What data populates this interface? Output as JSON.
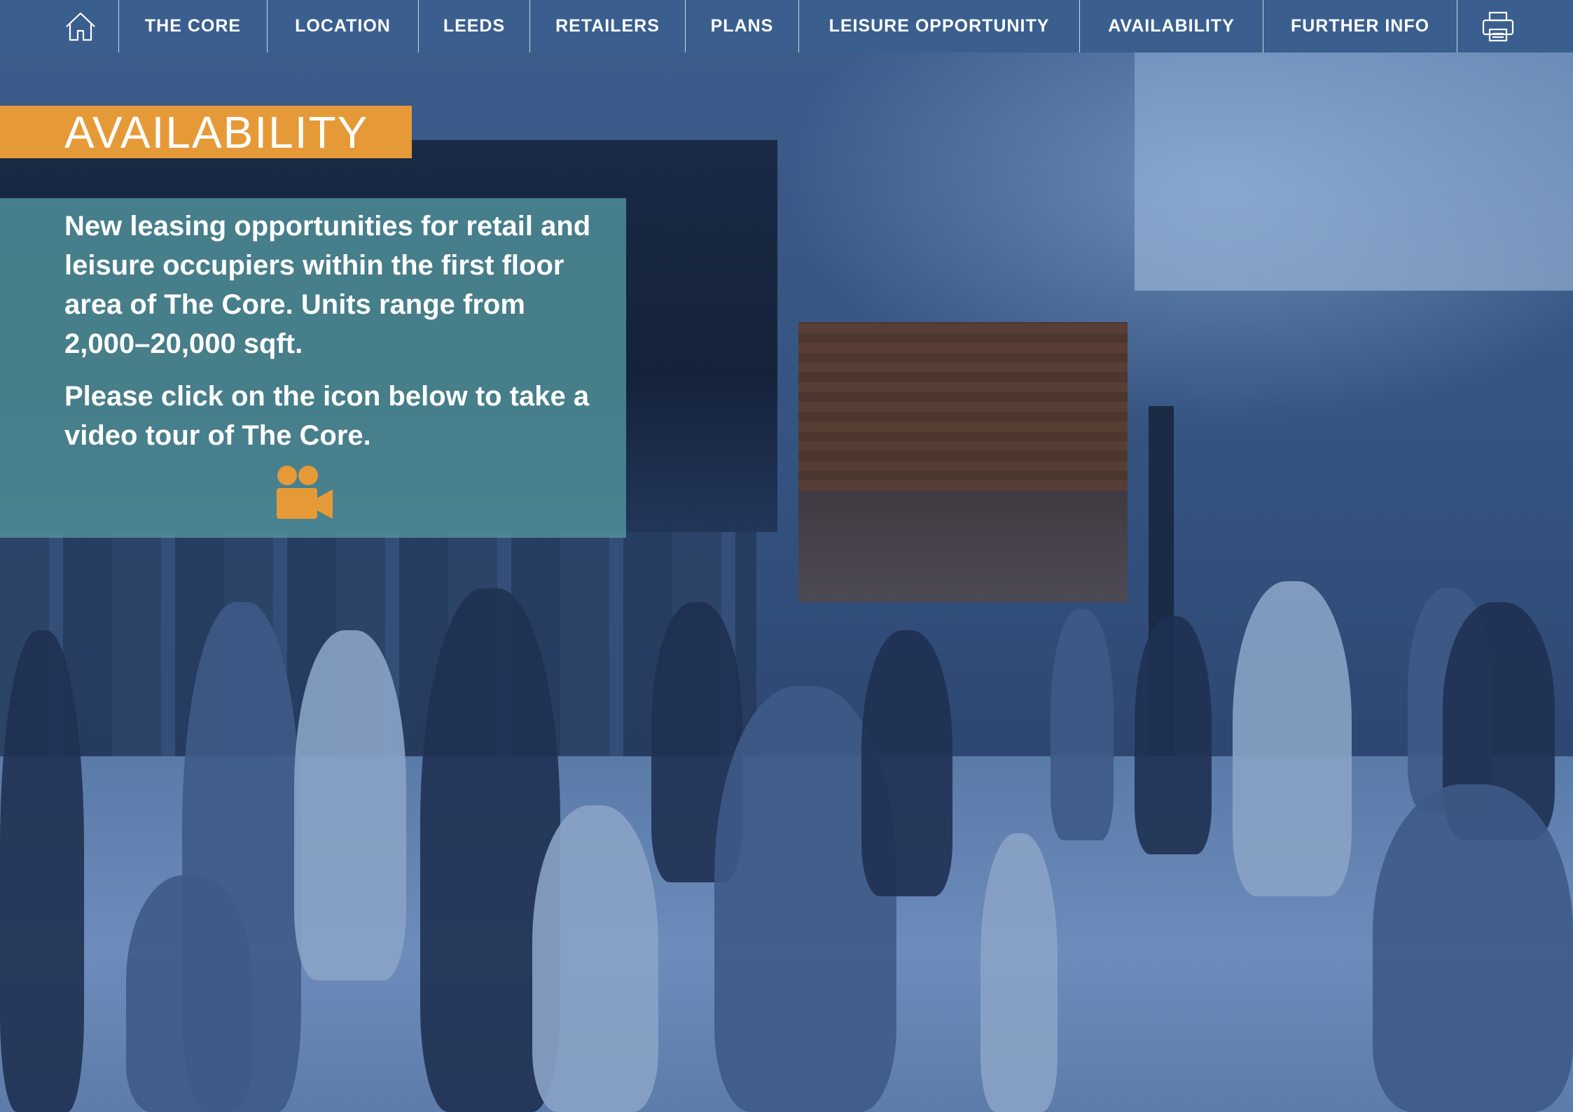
{
  "nav": {
    "items": [
      {
        "label": "THE CORE"
      },
      {
        "label": "LOCATION"
      },
      {
        "label": "LEEDS"
      },
      {
        "label": "RETAILERS"
      },
      {
        "label": "PLANS"
      },
      {
        "label": "LEISURE OPPORTUNITY"
      },
      {
        "label": "AVAILABILITY"
      },
      {
        "label": "FURTHER INFO"
      }
    ],
    "home_icon": "home-icon",
    "print_icon": "printer-icon"
  },
  "page": {
    "heading": "AVAILABILITY",
    "intro": "New leasing opportunities for retail and leisure occupiers within the first floor area of The Core. Units range from 2,000–20,000 sqft.",
    "video_prompt": "Please click on the icon below to take a video tour of The Core.",
    "video_icon": "video-camera-icon"
  },
  "colors": {
    "nav_bg": "#3a5f8e",
    "accent_orange": "#e69a37",
    "panel_teal": "#52959d",
    "text": "#ffffff"
  }
}
